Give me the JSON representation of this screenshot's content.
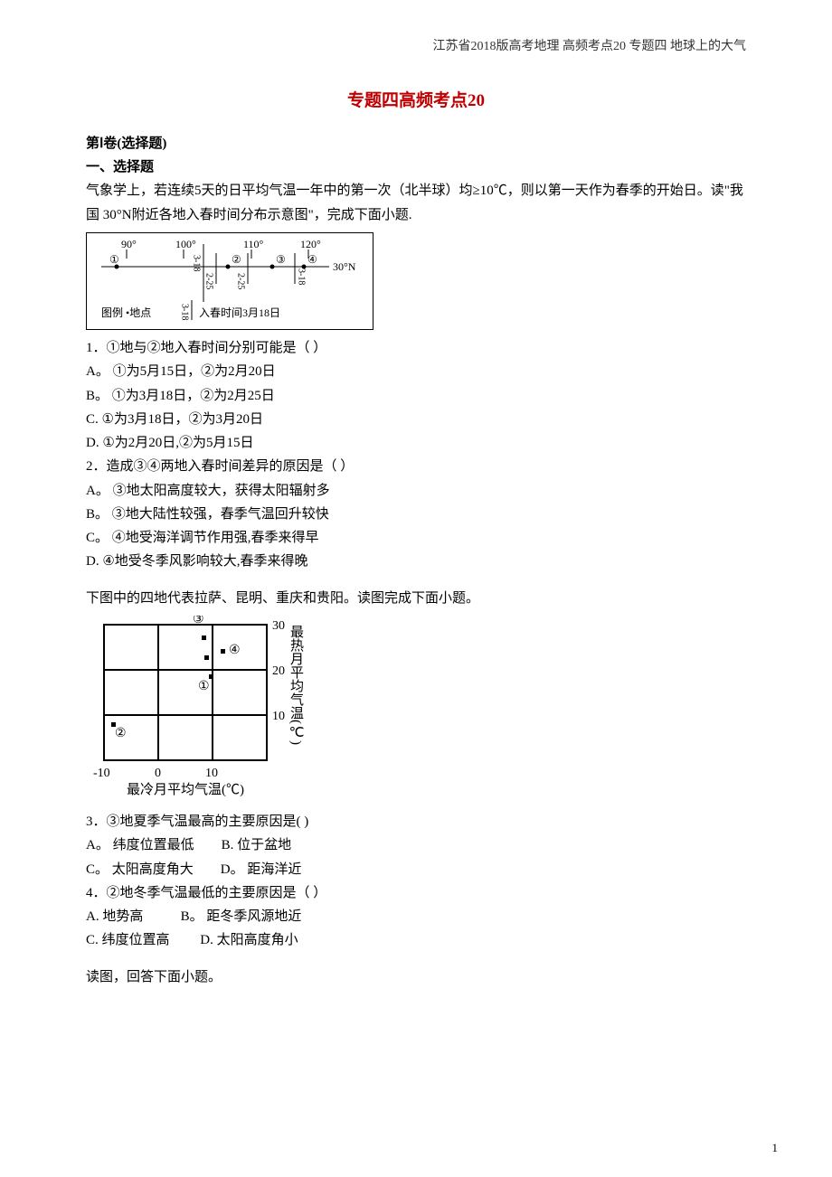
{
  "header": "江苏省2018版高考地理 高频考点20 专题四 地球上的大气",
  "title": "专题四高频考点20",
  "section1": "第Ⅰ卷(选择题)",
  "section2": "一、选择题",
  "intro1": "气象学上，若连续5天的日平均气温一年中的第一次（北半球）均≥10℃，则以第一天作为春季的开始日。读\"我国 30°N附近各地入春时间分布示意图\"，完成下面小题.",
  "fig1": {
    "lon90": "90°",
    "lon100": "100°",
    "lon110": "110°",
    "lon120": "120°",
    "lat": "30°N",
    "p1": "①",
    "p2": "②",
    "p3": "③",
    "p4": "④",
    "iso318a": "3-18",
    "iso225a": "2-25",
    "iso225b": "2-25",
    "iso318b": "3-18",
    "legend": "图例 •地点",
    "legend2": "入春时间3月18日",
    "legend_iso": "3-18"
  },
  "q1": {
    "stem": "1．①地与②地入春时间分别可能是（    ）",
    "A": "A。  ①为5月15日，②为2月20日",
    "B": "B。  ①为3月18日，②为2月25日",
    "C": "C.   ①为3月18日，②为3月20日",
    "D": "D.   ①为2月20日,②为5月15日"
  },
  "q2": {
    "stem": "2．造成③④两地入春时间差异的原因是（    ）",
    "A": "A。   ③地太阳高度较大，获得太阳辐射多",
    "B": "B。   ③地大陆性较强，春季气温回升较快",
    "C": "C。   ④地受海洋调节作用强,春季来得早",
    "D": "D.    ④地受冬季风影响较大,春季来得晚"
  },
  "intro2": "下图中的四地代表拉萨、昆明、重庆和贵阳。读图完成下面小题。",
  "fig2": {
    "p1": "①",
    "p2": "②",
    "p3": "③",
    "p4": "④",
    "y30": "30",
    "y20": "20",
    "y10": "10",
    "xm10": "-10",
    "x0": "0",
    "x10": "10",
    "ylabel": "最热月平均气温(℃)",
    "xlabel": "最冷月平均气温(℃)"
  },
  "q3": {
    "stem": "3．③地夏季气温最高的主要原因是(    )",
    "A": "A。   纬度位置最低",
    "B": "B.    位于盆地",
    "C": "C。   太阳高度角大",
    "D": "D。   距海洋近"
  },
  "q4": {
    "stem": "4．②地冬季气温最低的主要原因是（    ）",
    "A": "A.   地势高",
    "B": "B。   距冬季风源地近",
    "C": "C.   纬度位置高",
    "D": "D.    太阳高度角小"
  },
  "intro3": "读图，回答下面小题。",
  "page": "1"
}
